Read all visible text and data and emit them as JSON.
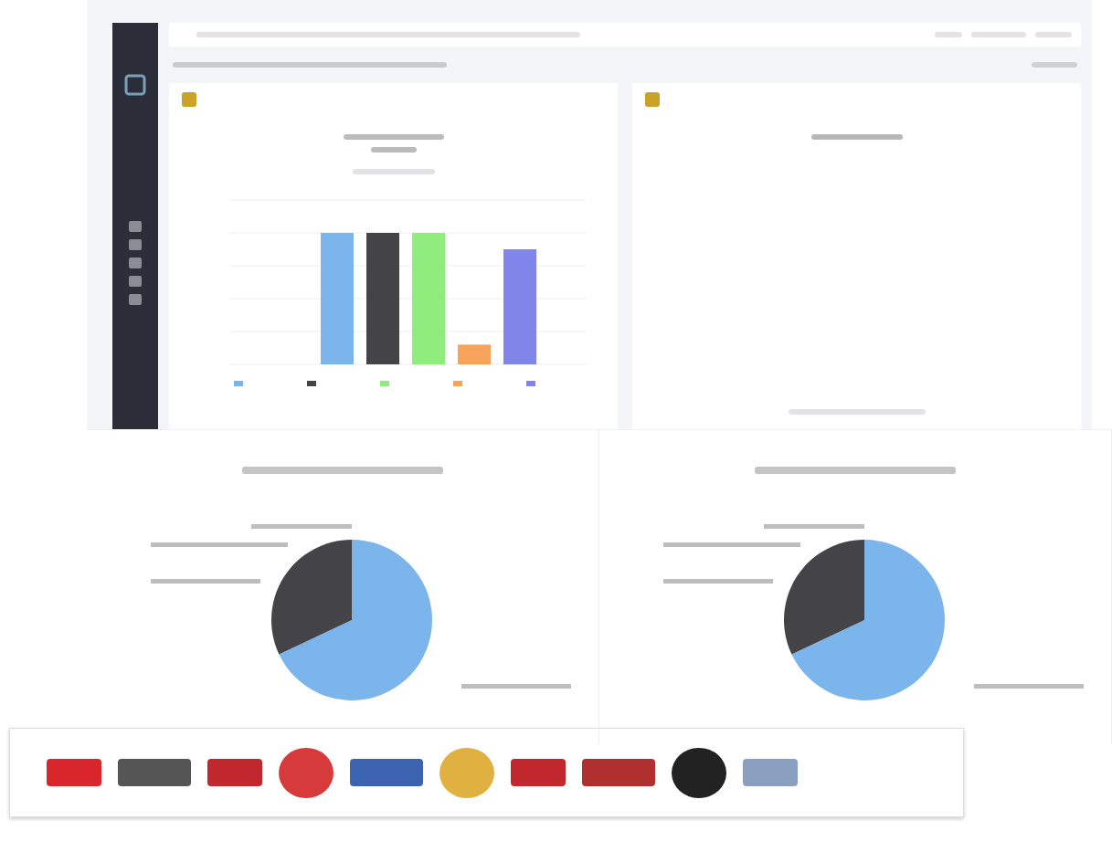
{
  "bar_chart": {
    "bars": [
      {
        "color": "#7cb5ec"
      },
      {
        "color": "#434348"
      },
      {
        "color": "#90ed7d"
      },
      {
        "color": "#f7a35c"
      },
      {
        "color": "#8085e9"
      }
    ]
  },
  "pie_charts": [
    {
      "slices": [
        {
          "color": "#7cb5ec"
        },
        {
          "color": "#434348"
        }
      ]
    },
    {
      "slices": [
        {
          "color": "#7cb5ec"
        },
        {
          "color": "#434348"
        }
      ]
    }
  ]
}
